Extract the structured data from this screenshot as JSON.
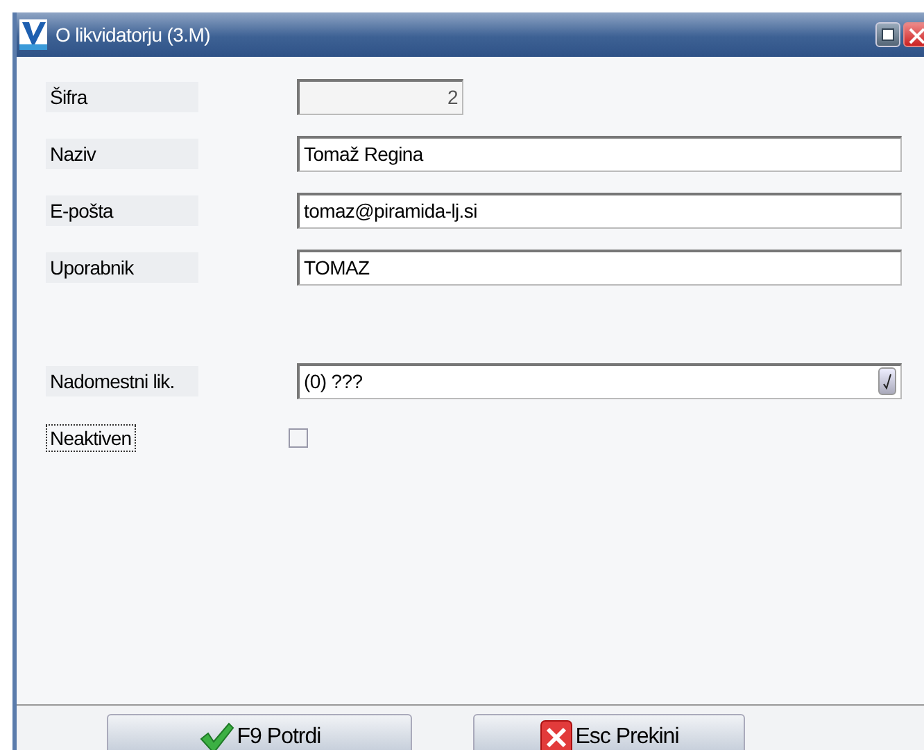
{
  "window": {
    "title": "O likvidatorju  (3.M)"
  },
  "fields": [
    {
      "kind": "number",
      "label": "Šifra",
      "value": "2",
      "disabled": true
    },
    {
      "kind": "text",
      "label": "Naziv",
      "value": "Tomaž Regina",
      "disabled": false
    },
    {
      "kind": "text",
      "label": "E-pošta",
      "value": "tomaz@piramida-lj.si",
      "disabled": false
    },
    {
      "kind": "text",
      "label": "Uporabnik",
      "value": "TOMAZ",
      "disabled": false
    },
    {
      "kind": "lookup",
      "label": "Nadomestni lik.",
      "value": "(0) ???",
      "disabled": false
    },
    {
      "kind": "checkbox",
      "label": "Neaktiven",
      "checked": false
    }
  ],
  "buttons": [
    {
      "kind": "confirm",
      "label": "F9 Potrdi"
    },
    {
      "kind": "cancel",
      "label": "Esc Prekini"
    }
  ]
}
